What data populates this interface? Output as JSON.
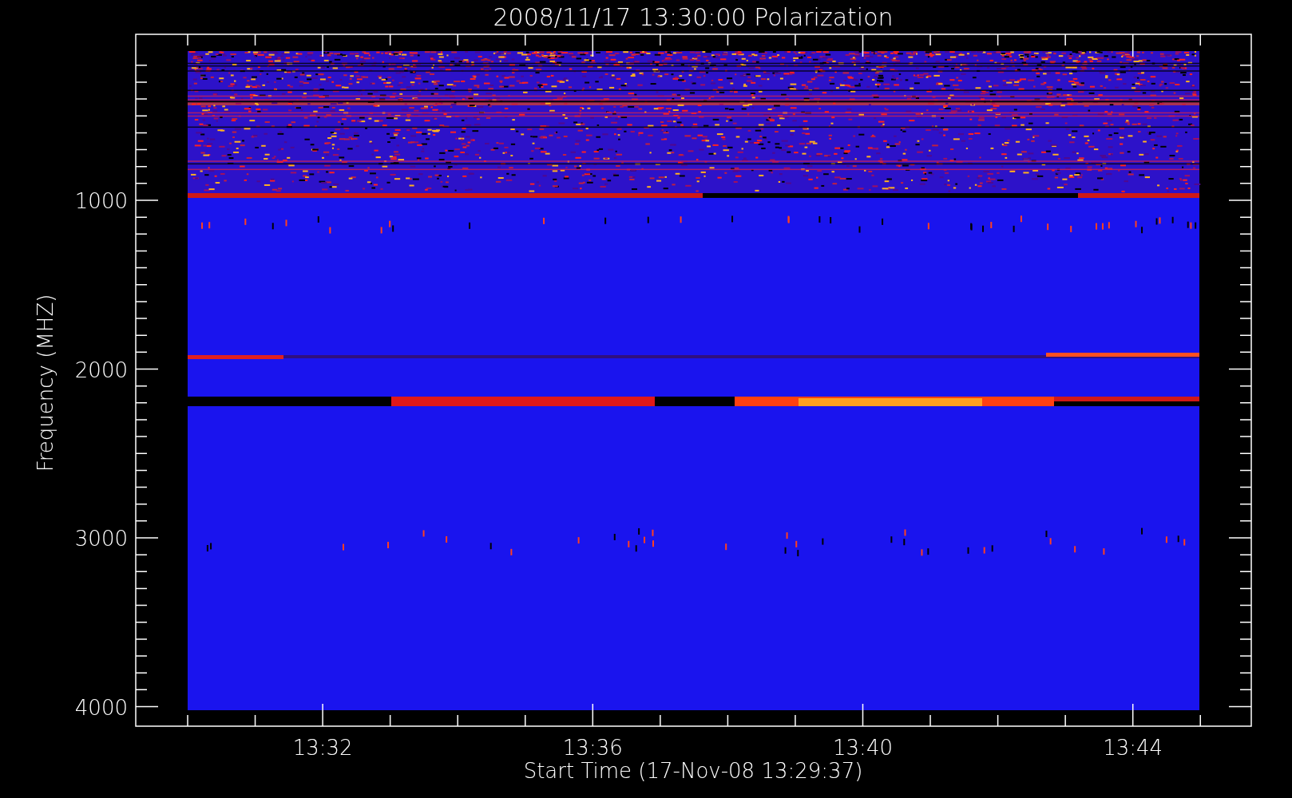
{
  "title": "2008/11/17 13:30:00 Polarization",
  "y_axis": {
    "label": "Frequency (MHZ)",
    "ticks": [
      "1000",
      "2000",
      "3000",
      "4000"
    ]
  },
  "x_axis": {
    "label": "Start Time (17-Nov-08 13:29:37)",
    "ticks": [
      "13:32",
      "13:36",
      "13:40",
      "13:44"
    ]
  }
}
